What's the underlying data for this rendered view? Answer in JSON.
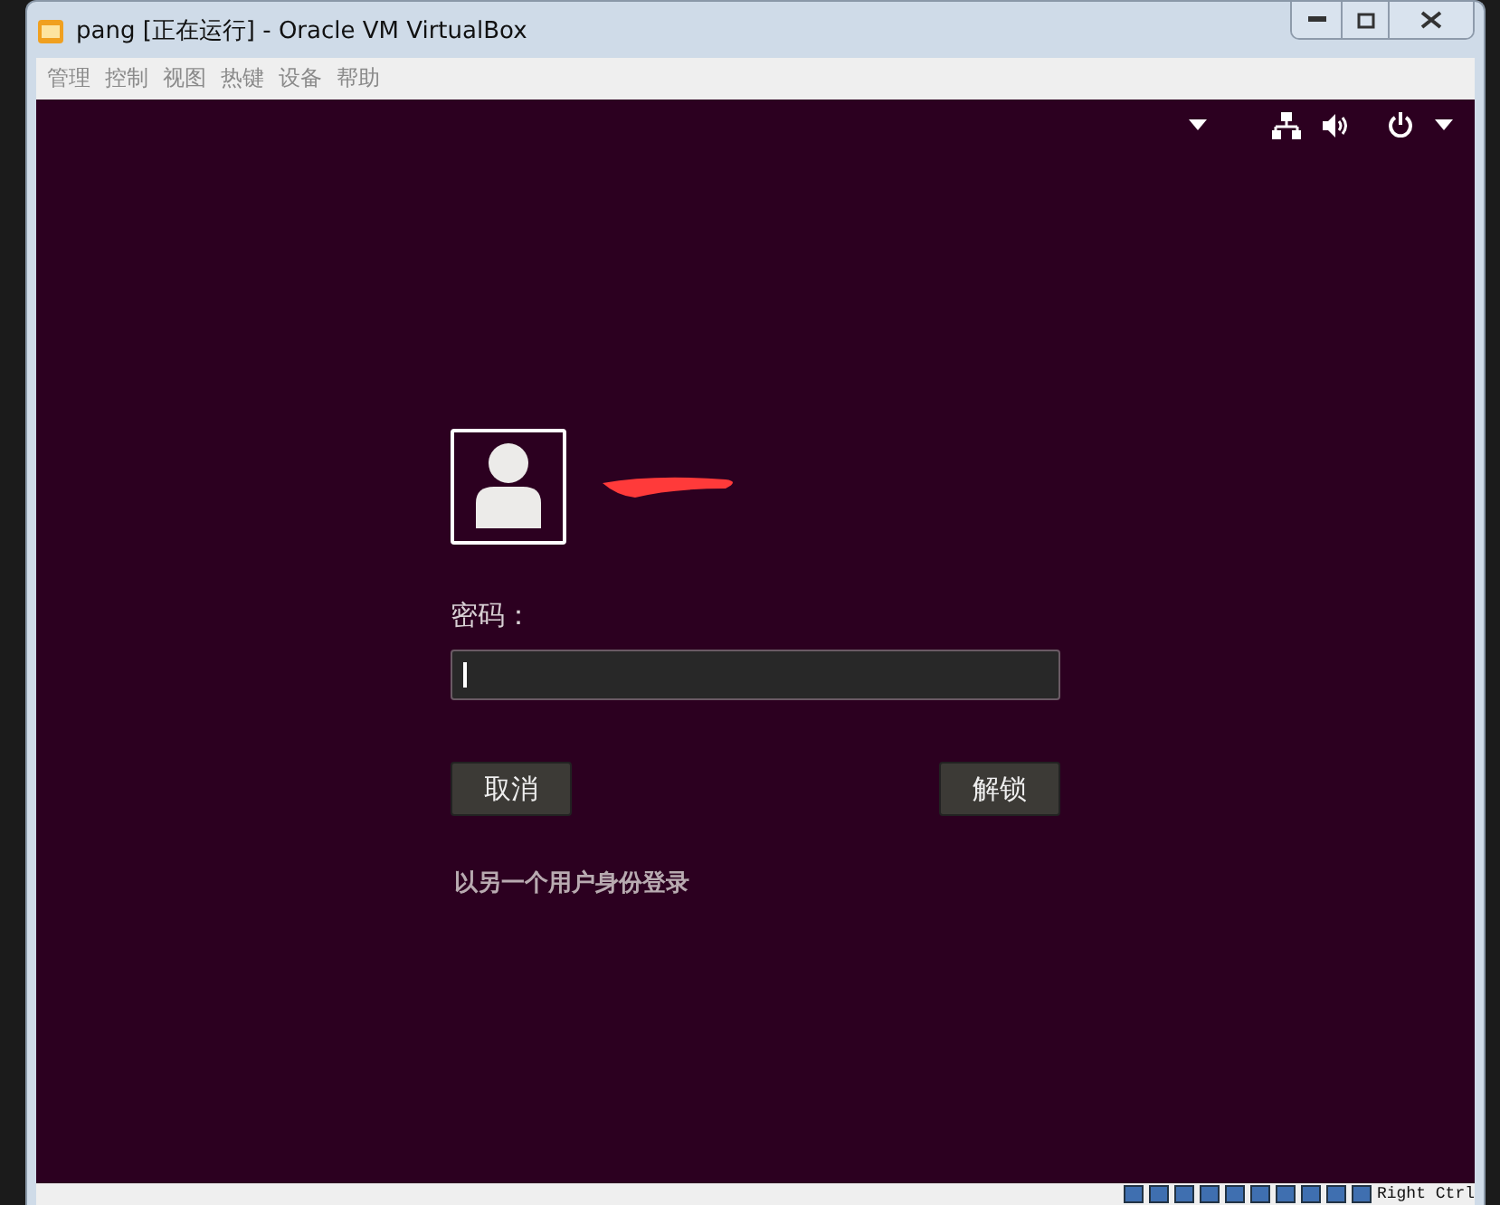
{
  "window": {
    "title": "pang [正在运行] - Oracle VM VirtualBox"
  },
  "menu": [
    "管理",
    "控制",
    "视图",
    "热键",
    "设备",
    "帮助"
  ],
  "login": {
    "password_label": "密码：",
    "buttons": [
      {
        "label": "取消"
      },
      {
        "label": "解锁"
      }
    ],
    "switch_user_link": "以另一个用户身份登录"
  },
  "status_bar": {
    "host_key": "Right Ctrl"
  }
}
